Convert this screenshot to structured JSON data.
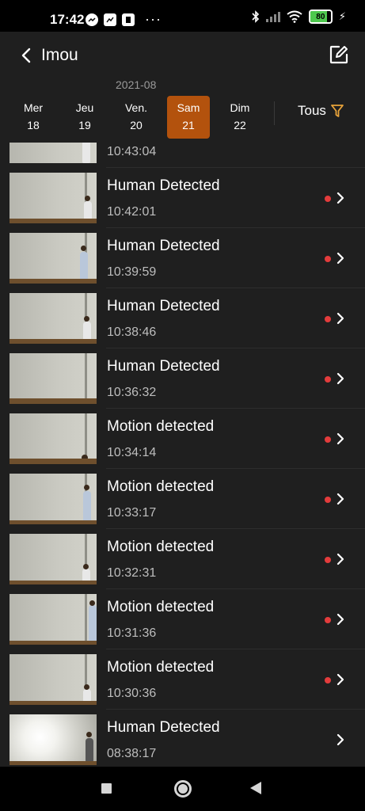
{
  "status_bar": {
    "time": "17:42",
    "battery": "80",
    "battery_level": 0.8,
    "icons": [
      "messenger-icon",
      "gallery-icon",
      "app-icon",
      "more-icon",
      "bluetooth-icon",
      "signal-icon",
      "wifi-icon",
      "battery-icon",
      "charging-icon"
    ],
    "more": "···"
  },
  "header": {
    "title": "Imou",
    "back_icon": "chevron-left-icon",
    "edit_icon": "edit-icon"
  },
  "date_picker": {
    "month": "2021-08",
    "days": [
      {
        "name": "Mer",
        "num": "18"
      },
      {
        "name": "Jeu",
        "num": "19"
      },
      {
        "name": "Ven.",
        "num": "20"
      },
      {
        "name": "Sam",
        "num": "21"
      },
      {
        "name": "Dim",
        "num": "22"
      }
    ],
    "selected_index": 3,
    "filter_label": "Tous",
    "filter_icon": "funnel-icon"
  },
  "events": [
    {
      "title": "",
      "time": "10:43:04",
      "unread": false
    },
    {
      "title": "Human Detected",
      "time": "10:42:01",
      "unread": true
    },
    {
      "title": "Human Detected",
      "time": "10:39:59",
      "unread": true
    },
    {
      "title": "Human Detected",
      "time": "10:38:46",
      "unread": true
    },
    {
      "title": "Human Detected",
      "time": "10:36:32",
      "unread": true
    },
    {
      "title": "Motion detected",
      "time": "10:34:14",
      "unread": true
    },
    {
      "title": "Motion detected",
      "time": "10:33:17",
      "unread": true
    },
    {
      "title": "Motion detected",
      "time": "10:32:31",
      "unread": true
    },
    {
      "title": "Motion detected",
      "time": "10:31:36",
      "unread": true
    },
    {
      "title": "Motion detected",
      "time": "10:30:36",
      "unread": true
    },
    {
      "title": "Human Detected",
      "time": "08:38:17",
      "unread": false
    }
  ],
  "colors": {
    "accent": "#b3520d",
    "filter_icon": "#e8a33a",
    "unread_dot": "#e33c3c",
    "background": "#1f1f1f"
  },
  "nav_bar": {
    "icons": [
      "recents-square-icon",
      "home-circle-icon",
      "back-triangle-icon"
    ]
  }
}
